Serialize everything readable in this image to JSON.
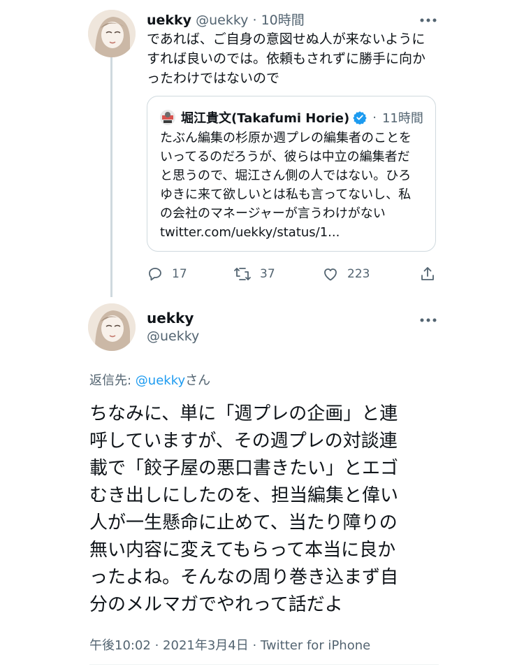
{
  "tweet1": {
    "display_name": "uekky",
    "handle": "@uekky",
    "separator": "·",
    "time": "10時間",
    "text_lines": [
      "であれば、ご自身の意図せぬ人が来ないように",
      "すれば良いのでは。依頼もされずに勝手に向か",
      "ったわけではないので"
    ],
    "quote": {
      "author": "堀江貴文(Takafumi Horie)",
      "verified": true,
      "separator": "·",
      "time": "11時間",
      "text_lines": [
        "たぶん編集の杉原か週プレの編集者のことを",
        "いってるのだろうが、彼らは中立の編集者だ",
        "と思うので、堀江さん側の人ではない。ひろ",
        "ゆきに来て欲しいとは私も言ってないし、私",
        "の会社のマネージャーが言うわけがない",
        "twitter.com/uekky/status/1..."
      ]
    },
    "actions": {
      "replies": "17",
      "retweets": "37",
      "likes": "223"
    }
  },
  "tweet2": {
    "display_name": "uekky",
    "handle": "@uekky",
    "replying_prefix": "返信先: ",
    "replying_handle": "@uekky",
    "replying_suffix": "さん",
    "text_lines": [
      "ちなみに、単に「週プレの企画」と連",
      "呼していますが、その週プレの対談連",
      "載で「餃子屋の悪口書きたい」とエゴ",
      "むき出しにしたのを、担当編集と偉い",
      "人が一生懸命に止めて、当たり障りの",
      "無い内容に変えてもらって本当に良か",
      "ったよね。そんなの周り巻き込まず自",
      "分のメルマガでやれって話だよ"
    ],
    "footer": "午後10:02 · 2021年3月4日 · Twitter for iPhone"
  },
  "icons": {
    "more": "more-icon",
    "reply": "reply-icon",
    "retweet": "retweet-icon",
    "like": "like-icon",
    "share": "share-icon",
    "verified": "verified-badge-icon"
  },
  "colors": {
    "text": "#0f1419",
    "secondary": "#536471",
    "accent": "#1d9bf0",
    "border": "#cfd9de"
  }
}
